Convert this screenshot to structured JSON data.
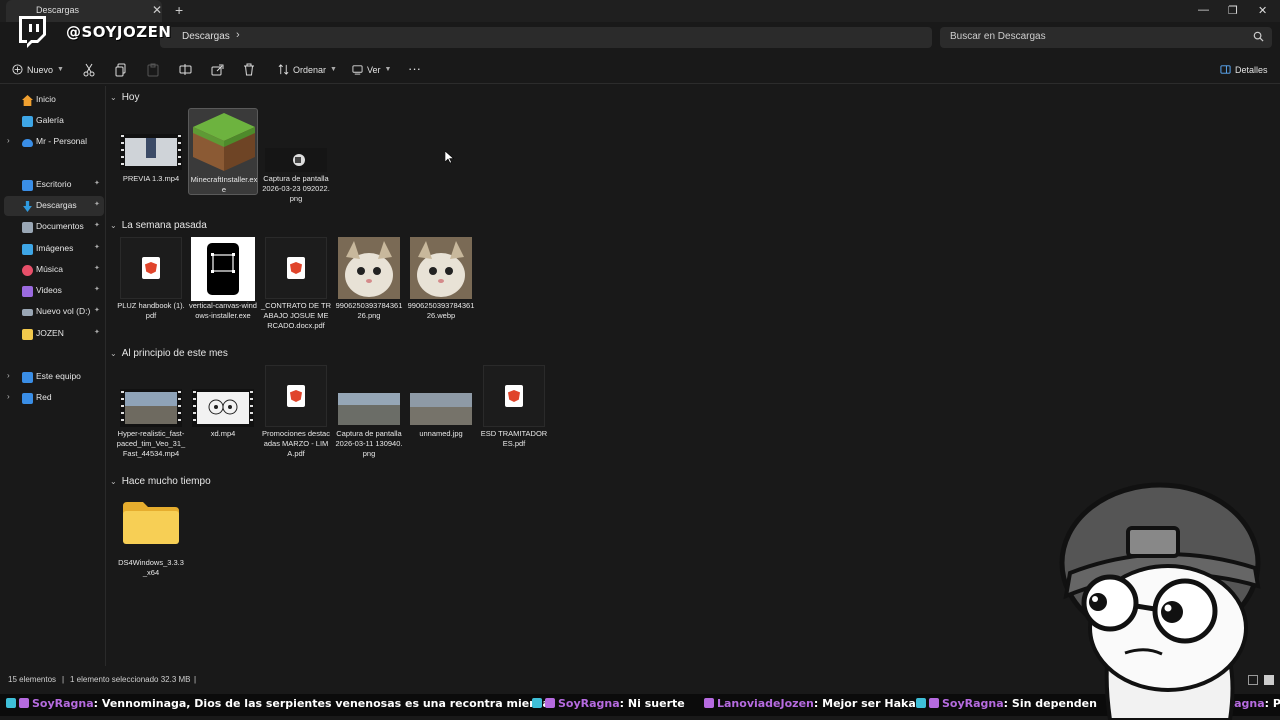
{
  "window": {
    "tab_label": "Descargas",
    "tab_close": "✕",
    "new_tab": "+",
    "minimize": "—",
    "maximize": "❐",
    "close": "✕"
  },
  "overlay": {
    "handle": "@SOYJOZEN"
  },
  "address": {
    "crumb": "Descargas",
    "sep": "›",
    "start": "›"
  },
  "search": {
    "placeholder": "Buscar en Descargas"
  },
  "toolbar": {
    "new_label": "Nuevo",
    "sort_label": "Ordenar",
    "view_label": "Ver",
    "more_label": "···",
    "details_label": "Detalles"
  },
  "nav": {
    "items": [
      {
        "label": "Inicio",
        "color": "#f0a030"
      },
      {
        "label": "Galería",
        "color": "#3ea6e6"
      },
      {
        "label": "Mr - Personal",
        "color": "#3a8ee6"
      },
      {
        "label": "Escritorio",
        "color": "#3a8ee6"
      },
      {
        "label": "Descargas",
        "color": "#2f9be0"
      },
      {
        "label": "Documentos",
        "color": "#9aa7b5"
      },
      {
        "label": "Imágenes",
        "color": "#3ea6e6"
      },
      {
        "label": "Música",
        "color": "#e8506a"
      },
      {
        "label": "Videos",
        "color": "#9b6be0"
      },
      {
        "label": "Nuevo vol (D:)",
        "color": "#9aa7b5"
      },
      {
        "label": "JOZEN",
        "color": "#f2c94c"
      },
      {
        "label": "Este equipo",
        "color": "#3a8ee6"
      },
      {
        "label": "Red",
        "color": "#3a8ee6"
      }
    ],
    "pin": "📌"
  },
  "groups": [
    {
      "title": "Hoy"
    },
    {
      "title": "La semana pasada"
    },
    {
      "title": "Al principio de este mes"
    },
    {
      "title": "Hace mucho tiempo"
    }
  ],
  "files": {
    "hoy": [
      {
        "name": "PREVIA 1.3.mp4"
      },
      {
        "name": "MinecraftInstaller.exe"
      },
      {
        "name": "Captura de pantalla 2026-03-23 092022.png"
      }
    ],
    "semana": [
      {
        "name": "PLUZ handbook (1).pdf"
      },
      {
        "name": "vertical-canvas-windows-installer.exe"
      },
      {
        "name": "_CONTRATO DE TRABAJO JOSUE MERCADO.docx.pdf"
      },
      {
        "name": "990625039378436126.png"
      },
      {
        "name": "990625039378436126.webp"
      }
    ],
    "mes": [
      {
        "name": "Hyper-realistic_fast-paced_tim_Veo_31_Fast_44534.mp4"
      },
      {
        "name": "xd.mp4"
      },
      {
        "name": "Promociones destacadas MARZO - LIMA.pdf"
      },
      {
        "name": "Captura de pantalla 2026-03-11 130940.png"
      },
      {
        "name": "unnamed.jpg"
      },
      {
        "name": "ESD TRAMITADORES.pdf"
      }
    ],
    "antiguo": [
      {
        "name": "DS4Windows_3.3.3_x64"
      }
    ]
  },
  "status": {
    "count": "15 elementos",
    "selection": "1 elemento seleccionado 32.3 MB",
    "sep": "|"
  },
  "ticker": {
    "messages": [
      {
        "user": "SoyRagna",
        "text": "Vennominaga, Dios de las serpientes venenosas es una recontra mierda"
      },
      {
        "user": "SoyRagna",
        "text": "Ni suerte"
      },
      {
        "user": "LanoviadeJozen",
        "text": "Mejor ser Hakari"
      },
      {
        "user": "SoyRagna",
        "text": "Sin dependen"
      },
      {
        "user": "SoyRagna",
        "text": "Po"
      }
    ],
    "colon": ":"
  }
}
